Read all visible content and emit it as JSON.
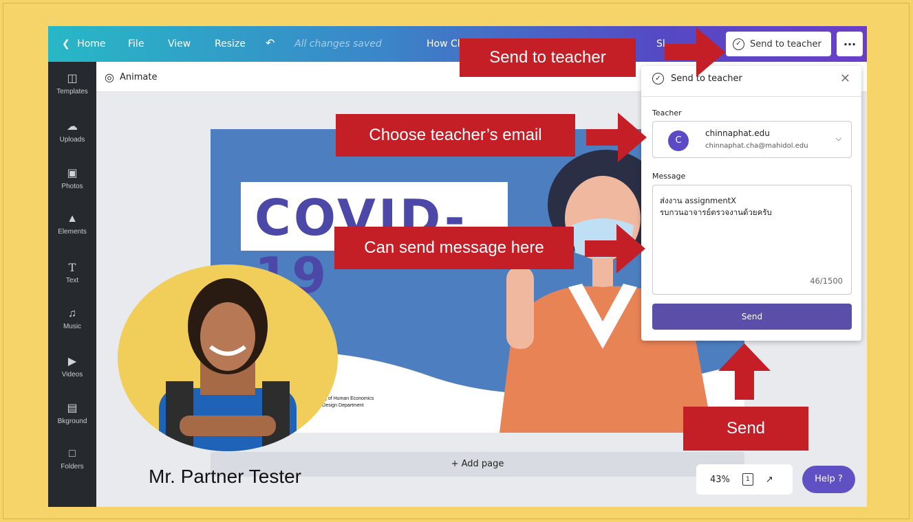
{
  "topbar": {
    "home": "Home",
    "file": "File",
    "view": "View",
    "resize": "Resize",
    "saved": "All changes saved",
    "title_partial": "How Cl",
    "share_partial": "Sl",
    "send_to_teacher": "Send to teacher",
    "more": "···"
  },
  "sidebar": {
    "items": [
      {
        "label": "Templates",
        "icon": "templates-icon"
      },
      {
        "label": "Uploads",
        "icon": "uploads-icon"
      },
      {
        "label": "Photos",
        "icon": "photos-icon"
      },
      {
        "label": "Elements",
        "icon": "elements-icon"
      },
      {
        "label": "Text",
        "icon": "text-icon"
      },
      {
        "label": "Music",
        "icon": "music-icon"
      },
      {
        "label": "Videos",
        "icon": "videos-icon"
      },
      {
        "label": "Bkground",
        "icon": "background-icon"
      },
      {
        "label": "Folders",
        "icon": "folders-icon"
      }
    ]
  },
  "subbar": {
    "animate": "Animate"
  },
  "design": {
    "headline": "COVID-19",
    "dept_line1": "lleg of Human Economics",
    "dept_line2": "r Design Department"
  },
  "canvas": {
    "add_page": "+ Add page",
    "zoom": "43%",
    "page_number": "1",
    "help": "Help ?"
  },
  "panel": {
    "title": "Send to teacher",
    "teacher_label": "Teacher",
    "teacher_initial": "C",
    "teacher_name": "chinnaphat.edu",
    "teacher_email": "chinnaphat.cha@mahidol.edu",
    "message_label": "Message",
    "message_line1": "ส่งงาน assignmentX",
    "message_line2": "รบกวนอาจารย์ตรวจงานด้วยครับ",
    "char_count": "46/1500",
    "send": "Send"
  },
  "annotations": {
    "send_to_teacher": "Send to teacher",
    "choose_email": "Choose teacher’s email",
    "send_message": "Can send message here",
    "send": "Send",
    "person_name": "Mr. Partner Tester"
  },
  "colors": {
    "background": "#f6d46a",
    "callout": "#c41f26",
    "send_button": "#5a4ea9",
    "avatar": "#5b49c6"
  }
}
